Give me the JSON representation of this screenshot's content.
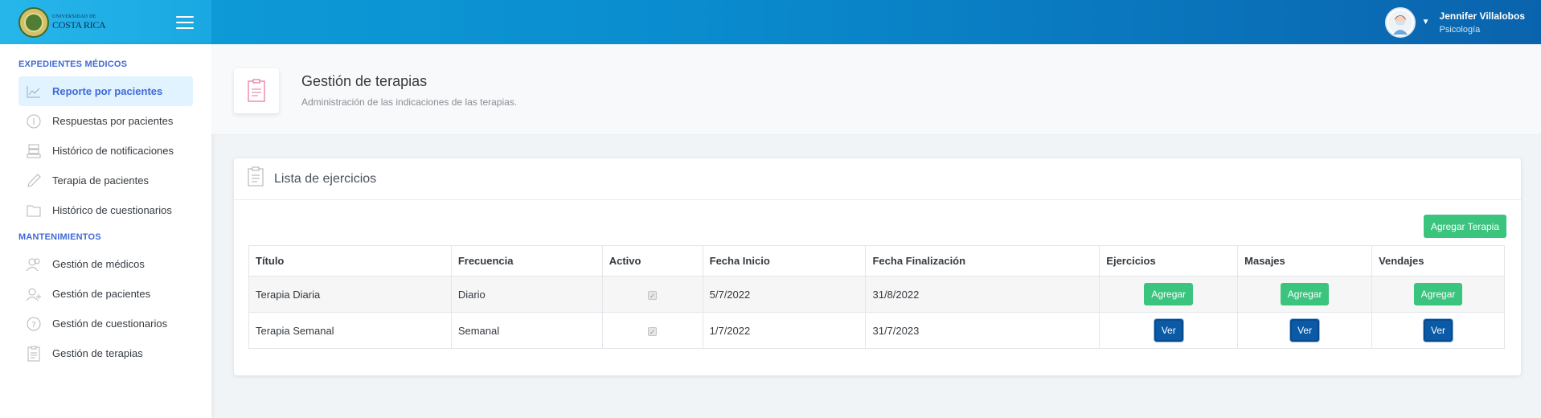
{
  "brand": {
    "logo_line1": "UNIVERSIDAD DE",
    "logo_line2": "COSTA RICA",
    "accent": "#3f6ad8",
    "success": "#3ac47d",
    "primary": "#0b5aa6"
  },
  "user": {
    "name": "Jennifer Villalobos",
    "role": "Psicología"
  },
  "sidebar": {
    "sections": [
      {
        "title": "EXPEDIENTES MÉDICOS",
        "items": [
          {
            "label": "Reporte por pacientes",
            "icon": "chart-line-icon",
            "active": true
          },
          {
            "label": "Respuestas por pacientes",
            "icon": "info-circle-icon"
          },
          {
            "label": "Histórico de notificaciones",
            "icon": "server-icon"
          },
          {
            "label": "Terapia de pacientes",
            "icon": "pencil-icon"
          },
          {
            "label": "Histórico de cuestionarios",
            "icon": "folder-icon"
          }
        ]
      },
      {
        "title": "MANTENIMIENTOS",
        "items": [
          {
            "label": "Gestión de médicos",
            "icon": "users-icon"
          },
          {
            "label": "Gestión de pacientes",
            "icon": "add-user-icon"
          },
          {
            "label": "Gestión de cuestionarios",
            "icon": "help-circle-icon"
          },
          {
            "label": "Gestión de terapias",
            "icon": "clipboard-icon"
          }
        ]
      }
    ]
  },
  "page": {
    "title": "Gestión de terapias",
    "subtitle": "Administración de las indicaciones de las terapias."
  },
  "card": {
    "title": "Lista de ejercicios",
    "add_button": "Agregar Terapia"
  },
  "table": {
    "headers": [
      "Título",
      "Frecuencia",
      "Activo",
      "Fecha Inicio",
      "Fecha Finalización",
      "Ejercicios",
      "Masajes",
      "Vendajes"
    ],
    "rows": [
      {
        "titulo": "Terapia Diaria",
        "frecuencia": "Diario",
        "activo": true,
        "inicio": "5/7/2022",
        "fin": "31/8/2022",
        "ejercicios": "Agregar",
        "masajes": "Agregar",
        "vendajes": "Agregar"
      },
      {
        "titulo": "Terapia Semanal",
        "frecuencia": "Semanal",
        "activo": true,
        "inicio": "1/7/2022",
        "fin": "31/7/2023",
        "ejercicios": "Ver",
        "masajes": "Ver",
        "vendajes": "Ver"
      }
    ]
  }
}
